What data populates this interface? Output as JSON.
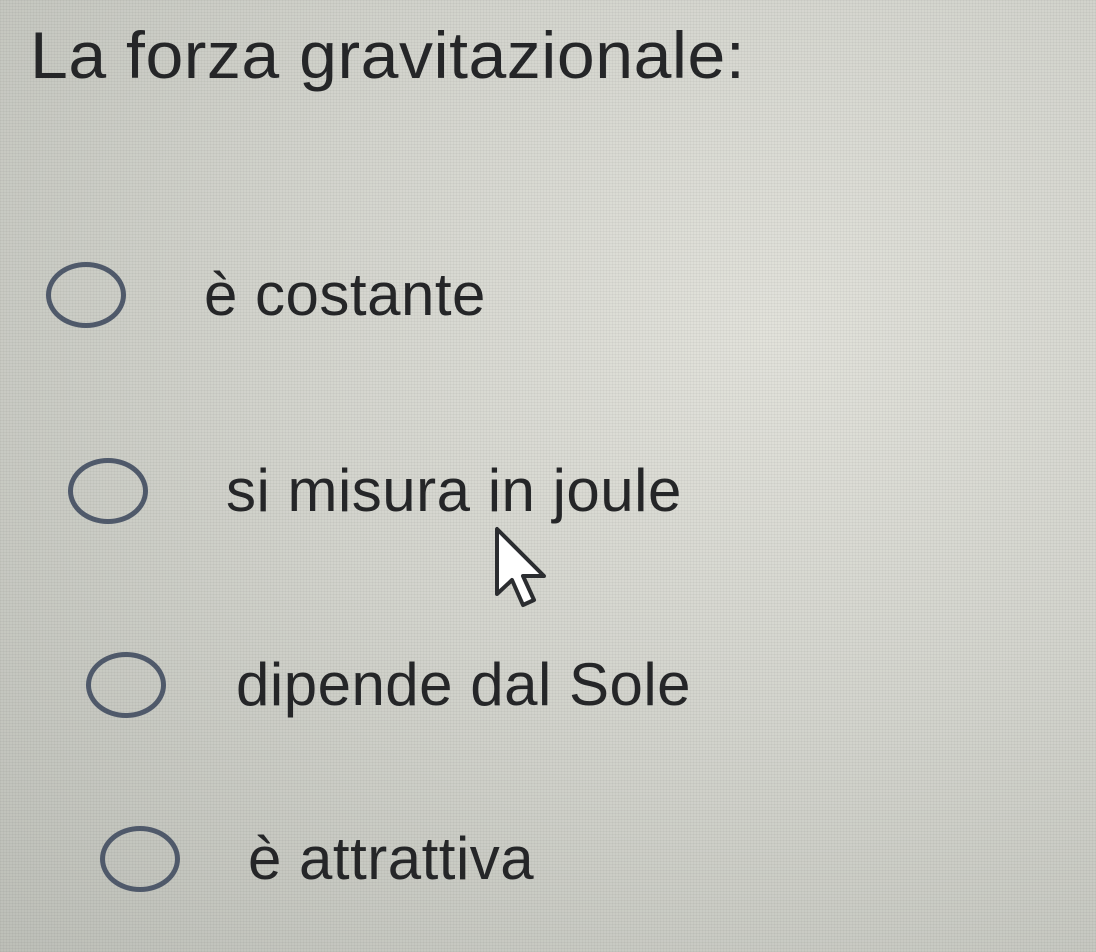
{
  "question": {
    "title": "La forza gravitazionale:"
  },
  "options": [
    {
      "label": "è costante",
      "selected": false
    },
    {
      "label": "si misura in joule",
      "selected": false
    },
    {
      "label": "dipende dal Sole",
      "selected": false
    },
    {
      "label": "è attrattiva",
      "selected": false
    }
  ],
  "cursor": {
    "icon": "arrow-pointer-icon"
  },
  "colors": {
    "text": "#252628",
    "radio_border": "#4f596a",
    "background": "#d3d4cd"
  }
}
